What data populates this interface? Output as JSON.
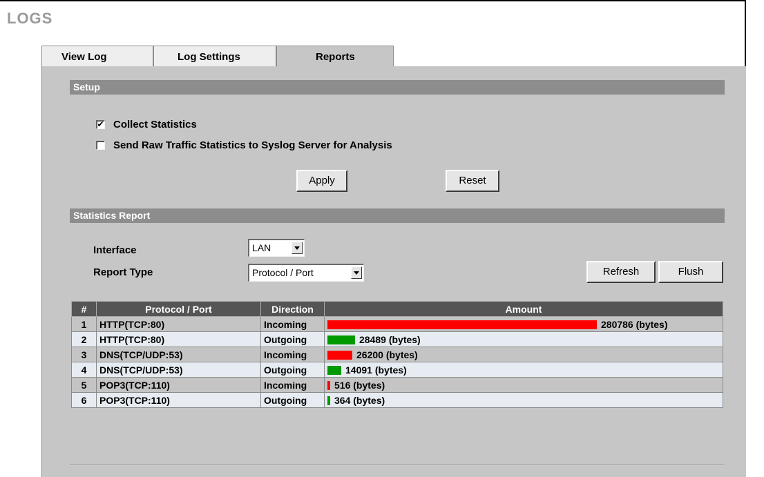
{
  "page": {
    "title": "LOGS"
  },
  "tabs": [
    {
      "label": "View Log"
    },
    {
      "label": "Log Settings"
    },
    {
      "label": "Reports"
    }
  ],
  "setup": {
    "heading": "Setup",
    "collect_statistics": {
      "label": "Collect Statistics",
      "checked": true
    },
    "send_raw": {
      "label": "Send Raw Traffic Statistics to Syslog Server for Analysis",
      "checked": false
    },
    "apply_label": "Apply",
    "reset_label": "Reset"
  },
  "report": {
    "heading": "Statistics Report",
    "interface_label": "Interface",
    "interface_value": "LAN",
    "report_type_label": "Report Type",
    "report_type_value": "Protocol / Port",
    "refresh_label": "Refresh",
    "flush_label": "Flush",
    "columns": [
      "#",
      "Protocol / Port",
      "Direction",
      "Amount"
    ],
    "rows": [
      {
        "num": "1",
        "protocol": "HTTP(TCP:80)",
        "direction": "Incoming",
        "amount": "280786 (bytes)",
        "bytes": 280786,
        "color": "#ff0000"
      },
      {
        "num": "2",
        "protocol": "HTTP(TCP:80)",
        "direction": "Outgoing",
        "amount": "28489 (bytes)",
        "bytes": 28489,
        "color": "#009900"
      },
      {
        "num": "3",
        "protocol": "DNS(TCP/UDP:53)",
        "direction": "Incoming",
        "amount": "26200 (bytes)",
        "bytes": 26200,
        "color": "#ff0000"
      },
      {
        "num": "4",
        "protocol": "DNS(TCP/UDP:53)",
        "direction": "Outgoing",
        "amount": "14091 (bytes)",
        "bytes": 14091,
        "color": "#009900"
      },
      {
        "num": "5",
        "protocol": "POP3(TCP:110)",
        "direction": "Incoming",
        "amount": "516 (bytes)",
        "bytes": 516,
        "color": "#ff0000"
      },
      {
        "num": "6",
        "protocol": "POP3(TCP:110)",
        "direction": "Outgoing",
        "amount": "364 (bytes)",
        "bytes": 364,
        "color": "#009900"
      }
    ]
  }
}
